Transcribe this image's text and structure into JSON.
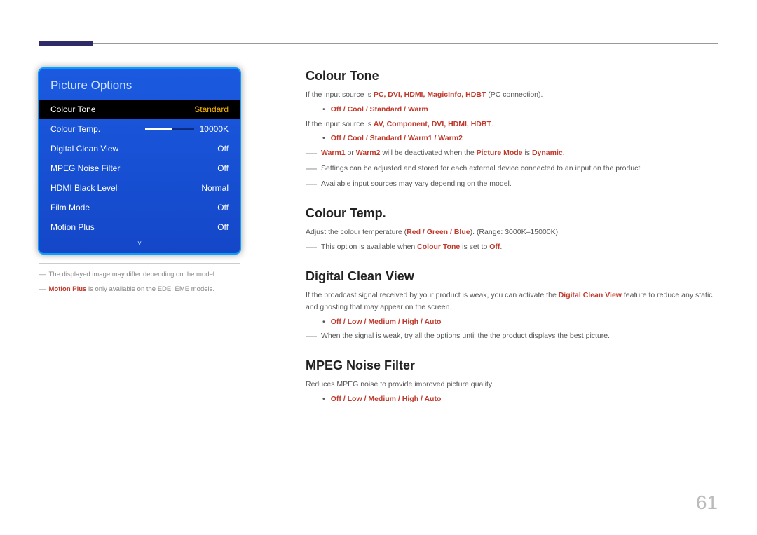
{
  "page_number": "61",
  "panel": {
    "title": "Picture Options",
    "rows": [
      {
        "label": "Colour Tone",
        "value": "Standard",
        "selected": true
      },
      {
        "label": "Colour Temp.",
        "value": "10000K",
        "slider": true
      },
      {
        "label": "Digital Clean View",
        "value": "Off"
      },
      {
        "label": "MPEG Noise Filter",
        "value": "Off"
      },
      {
        "label": "HDMI Black Level",
        "value": "Normal"
      },
      {
        "label": "Film Mode",
        "value": "Off"
      },
      {
        "label": "Motion Plus",
        "value": "Off"
      }
    ],
    "more": "˅"
  },
  "left_footnotes": {
    "f1": "The displayed image may differ depending on the model.",
    "f2_red": "Motion Plus",
    "f2_rest": " is only available on the EDE, EME models."
  },
  "sections": {
    "colour_tone": {
      "title": "Colour Tone",
      "line1_pre": "If the input source is ",
      "line1_terms": "PC, DVI, HDMI, MagicInfo, HDBT",
      "line1_post": " (PC connection).",
      "opts1": "Off / Cool / Standard / Warm",
      "line2_pre": "If the input source is ",
      "line2_terms": "AV, Component, DVI, HDMI, HDBT",
      "line2_post": ".",
      "opts2": "Off / Cool / Standard / Warm1 / Warm2",
      "dash1_a": "Warm1",
      "dash1_b": " or ",
      "dash1_c": "Warm2",
      "dash1_d": " will be deactivated when the ",
      "dash1_e": "Picture Mode",
      "dash1_f": " is ",
      "dash1_g": "Dynamic",
      "dash1_h": ".",
      "dash2": "Settings can be adjusted and stored for each external device connected to an input on the product.",
      "dash3": "Available input sources may vary depending on the model."
    },
    "colour_temp": {
      "title": "Colour Temp.",
      "line_pre": "Adjust the colour temperature (",
      "rgb": "Red / Green / Blue",
      "line_post": "). (Range: 3000K–15000K)",
      "dash_a": "This option is available when ",
      "dash_b": "Colour Tone",
      "dash_c": " is set to ",
      "dash_d": "Off",
      "dash_e": "."
    },
    "dcv": {
      "title": "Digital Clean View",
      "para_a": "If the broadcast signal received by your product is weak, you can activate the ",
      "para_b": "Digital Clean View",
      "para_c": " feature to reduce any static and ghosting that may appear on the screen.",
      "opts": "Off / Low / Medium / High / Auto",
      "dash": "When the signal is weak, try all the options until the the product displays the best picture."
    },
    "mpeg": {
      "title": "MPEG Noise Filter",
      "para": "Reduces MPEG noise to provide improved picture quality.",
      "opts": "Off / Low / Medium / High / Auto"
    }
  }
}
